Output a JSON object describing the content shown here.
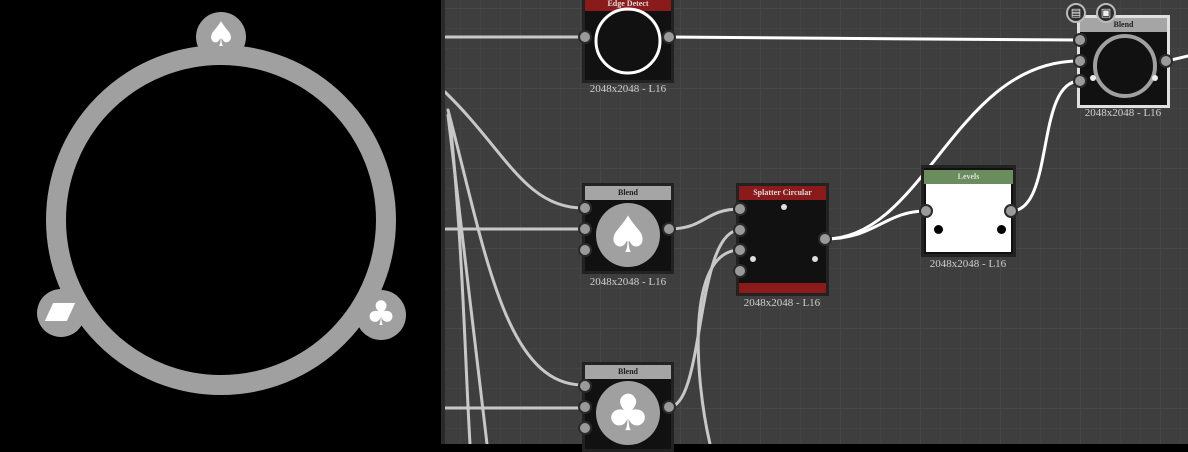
{
  "preview": {
    "ring_color": "#a0a0a0",
    "badges": [
      {
        "name": "spade",
        "glyph": "♠"
      },
      {
        "name": "diamond",
        "glyph": "♦"
      },
      {
        "name": "club",
        "glyph": "♣"
      }
    ]
  },
  "graph": {
    "nodes": {
      "edge_detect": {
        "title": "Edge Detect",
        "info": "2048x2048 - L16",
        "title_color": "#8b1a1a"
      },
      "blend_spade": {
        "title": "Blend",
        "info": "2048x2048 - L16",
        "title_color": "#a5a5a5"
      },
      "splatter": {
        "title": "Splatter Circular",
        "info": "2048x2048 - L16",
        "title_color": "#8b1a1a"
      },
      "levels": {
        "title": "Levels",
        "info": "2048x2048 - L16",
        "title_color": "#6b8c5c"
      },
      "blend_out": {
        "title": "Blend",
        "info": "2048x2048 - L16",
        "title_color": "#a5a5a5"
      },
      "blend_club": {
        "title": "Blend",
        "title_color": "#a5a5a5"
      }
    },
    "toolbar": {
      "doc_icon": "document-icon",
      "checker_icon": "checker-icon"
    }
  }
}
